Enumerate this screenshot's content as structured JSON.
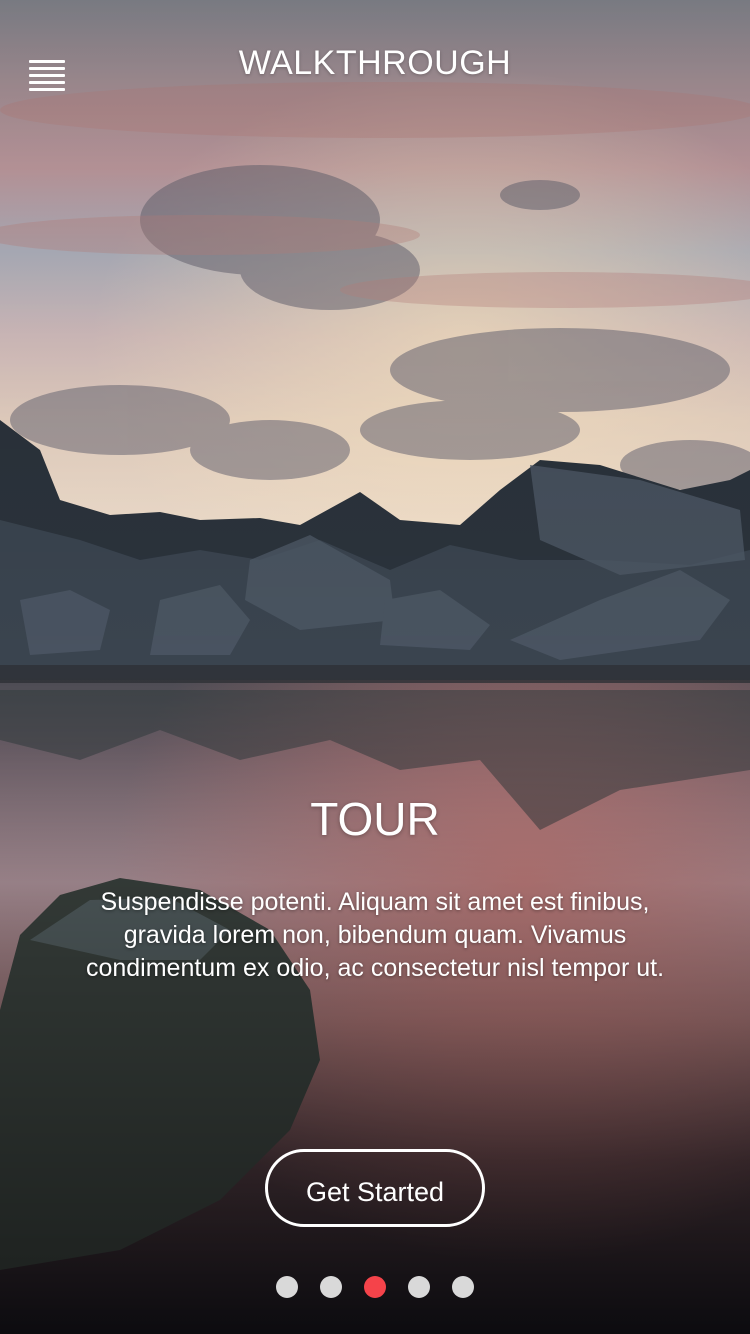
{
  "header": {
    "title": "WALKTHROUGH",
    "menu_icon": "hamburger-menu-icon"
  },
  "slide": {
    "title": "TOUR",
    "body": "Suspendisse potenti. Aliquam sit amet est finibus, gravida lorem non, bibendum quam. Vivamus condimentum ex odio, ac consectetur nisl tempor ut."
  },
  "cta": {
    "label": "Get Started"
  },
  "pager": {
    "total": 5,
    "active_index": 2,
    "active_color": "#f5434a",
    "inactive_color": "#d9d9d9"
  }
}
